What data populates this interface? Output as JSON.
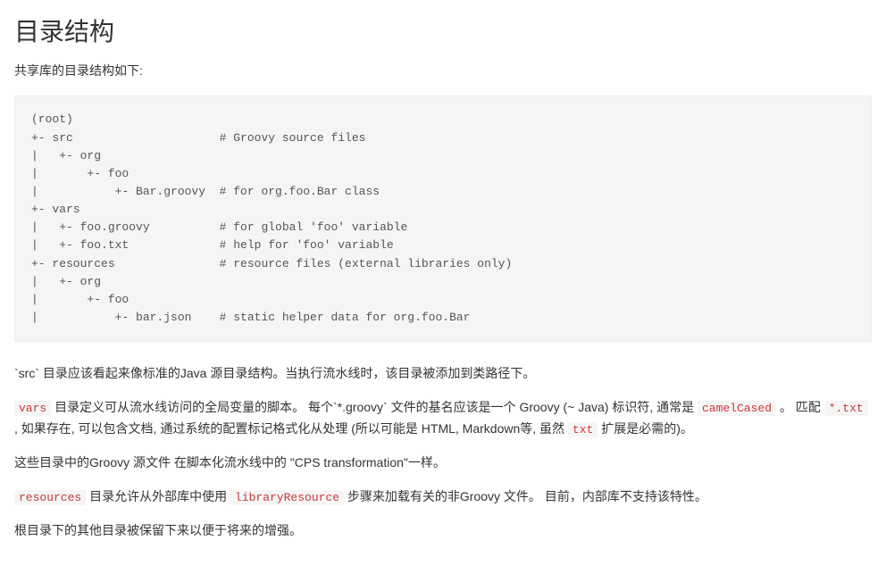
{
  "heading": "目录结构",
  "intro": "共享库的目录结构如下:",
  "codeblock": "(root)\n+- src                     # Groovy source files\n|   +- org\n|       +- foo\n|           +- Bar.groovy  # for org.foo.Bar class\n+- vars\n|   +- foo.groovy          # for global 'foo' variable\n|   +- foo.txt             # help for 'foo' variable\n+- resources               # resource files (external libraries only)\n|   +- org\n|       +- foo\n|           +- bar.json    # static helper data for org.foo.Bar",
  "para1": "`src` 目录应该看起来像标准的Java 源目录结构。当执行流水线时，该目录被添加到类路径下。",
  "para2": {
    "code1": "vars",
    "text1": " 目录定义可从流水线访问的全局变量的脚本。 每个`*.groovy` 文件的基名应该是一个 Groovy (~ Java) 标识符, 通常是 ",
    "code2": "camelCased",
    "text2": " 。 匹配 ",
    "code3": "*.txt",
    "text3": " , 如果存在, 可以包含文档, 通过系统的配置标记格式化从处理 (所以可能是 HTML, Markdown等, 虽然 ",
    "code4": "txt",
    "text4": " 扩展是必需的)。"
  },
  "para3": "这些目录中的Groovy 源文件 在脚本化流水线中的 \"CPS transformation\"一样。",
  "para4": {
    "code1": "resources",
    "text1": " 目录允许从外部库中使用 ",
    "code2": "libraryResource",
    "text2": " 步骤来加载有关的非Groovy 文件。 目前，内部库不支持该特性。"
  },
  "para5": "根目录下的其他目录被保留下来以便于将来的增强。"
}
